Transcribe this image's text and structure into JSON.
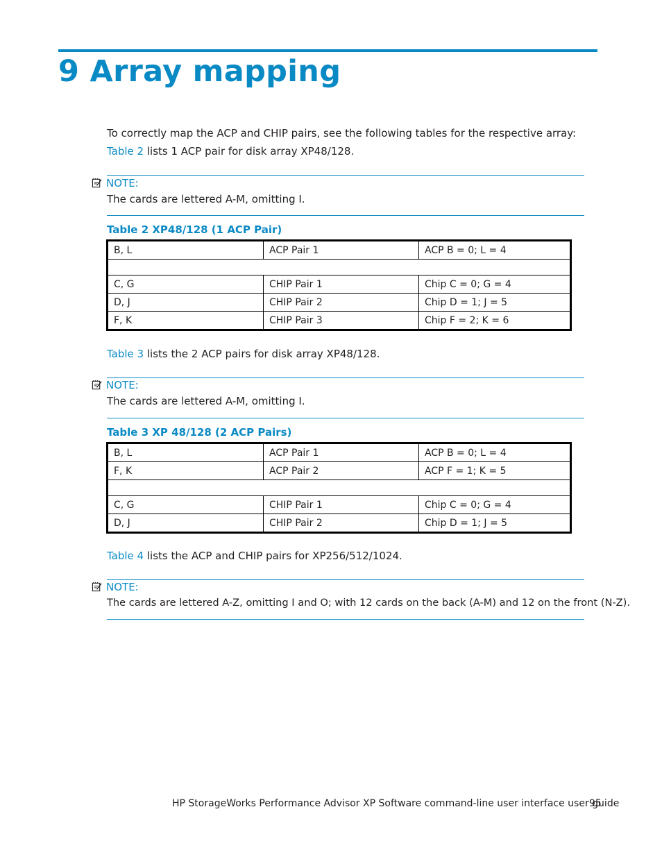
{
  "chapter": {
    "title": "9 Array mapping"
  },
  "intro": "To correctly map the ACP and CHIP pairs, see the following tables for the respective array:",
  "sections": [
    {
      "lead": {
        "link": "Table 2",
        "text": " lists 1 ACP pair for disk array XP48/128."
      },
      "note": {
        "label": "NOTE:",
        "text": "The cards are lettered A-M, omitting I."
      },
      "table": {
        "title": "Table 2 XP48/128 (1 ACP Pair)",
        "rows": [
          [
            "B, L",
            "ACP Pair 1",
            "ACP B = 0; L = 4"
          ],
          [
            "",
            "",
            ""
          ],
          [
            "C, G",
            "CHIP Pair 1",
            "Chip C = 0; G = 4"
          ],
          [
            "D, J",
            "CHIP Pair 2",
            "Chip D = 1; J = 5"
          ],
          [
            "F, K",
            "CHIP Pair 3",
            "Chip F = 2; K = 6"
          ]
        ]
      }
    },
    {
      "lead": {
        "link": "Table 3",
        "text": " lists the 2 ACP pairs for disk array XP48/128."
      },
      "note": {
        "label": "NOTE:",
        "text": "The cards are lettered A-M, omitting I."
      },
      "table": {
        "title": "Table 3 XP 48/128 (2 ACP Pairs)",
        "rows": [
          [
            "B, L",
            "ACP Pair 1",
            "ACP B = 0; L = 4"
          ],
          [
            "F, K",
            "ACP Pair 2",
            "ACP F = 1; K = 5"
          ],
          [
            "",
            "",
            ""
          ],
          [
            "C, G",
            "CHIP Pair 1",
            "Chip C = 0; G = 4"
          ],
          [
            "D, J",
            "CHIP Pair 2",
            "Chip D = 1; J = 5"
          ]
        ]
      }
    },
    {
      "lead": {
        "link": "Table 4",
        "text": " lists the ACP and CHIP pairs for XP256/512/1024."
      },
      "note": {
        "label": "NOTE:",
        "text": "The cards are lettered A-Z, omitting I and O; with 12 cards on the back (A-M) and 12 on the front (N-Z)."
      }
    }
  ],
  "footer": {
    "text": "HP StorageWorks Performance Advisor XP Software command-line user interface user guide",
    "page_number": "95"
  },
  "colors": {
    "accent": "#0a8ac4",
    "text": "#231f20"
  }
}
